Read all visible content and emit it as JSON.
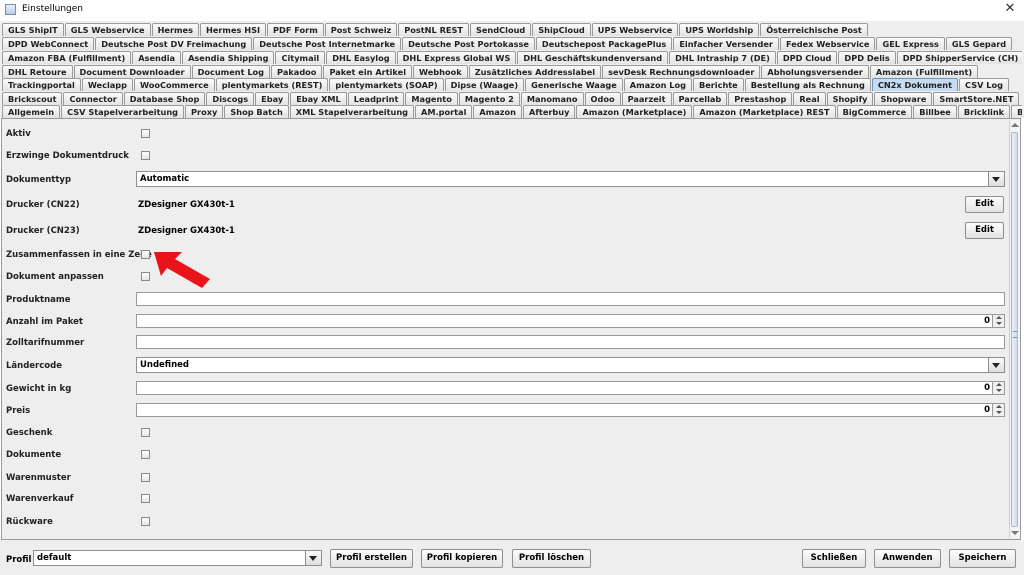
{
  "window": {
    "title": "Einstellungen"
  },
  "tabs": {
    "row1": [
      "GLS ShipIT",
      "GLS Webservice",
      "Hermes",
      "Hermes HSI",
      "PDF Form",
      "Post Schweiz",
      "PostNL REST",
      "SendCloud",
      "ShipCloud",
      "UPS Webservice",
      "UPS Worldship",
      "Österreichische Post"
    ],
    "row2": [
      "DPD WebConnect",
      "Deutsche Post DV Freimachung",
      "Deutsche Post Internetmarke",
      "Deutsche Post Portokasse",
      "Deutschepost PackagePlus",
      "Einfacher Versender",
      "Fedex Webservice",
      "GEL Express",
      "GLS Gepard"
    ],
    "row3": [
      "Amazon FBA (Fulfillment)",
      "Asendia",
      "Asendia Shipping",
      "Citymail",
      "DHL Easylog",
      "DHL Express Global WS",
      "DHL Geschäftskundenversand",
      "DHL Intraship 7 (DE)",
      "DPD Cloud",
      "DPD Delis",
      "DPD ShipperService (CH)"
    ],
    "row4": [
      "DHL Retoure",
      "Document Downloader",
      "Document Log",
      "Pakadoo",
      "Paket ein Artikel",
      "Webhook",
      "Zusätzliches Addresslabel",
      "sevDesk Rechnungsdownloader",
      "Abholungsversender",
      "Amazon (Fulfillment)"
    ],
    "row5": [
      "Trackingportal",
      "Weclapp",
      "WooCommerce",
      "plentymarkets (REST)",
      "plentymarkets (SOAP)",
      "Dipse (Waage)",
      "Generische Waage",
      "Amazon Log",
      "Berichte",
      "Bestellung als Rechnung",
      "CN2x Dokument",
      "CSV Log"
    ],
    "row6": [
      "Brickscout",
      "Connector",
      "Database Shop",
      "Discogs",
      "Ebay",
      "Ebay XML",
      "Leadprint",
      "Magento",
      "Magento 2",
      "Manomano",
      "Odoo",
      "Paarzeit",
      "Parcellab",
      "Prestashop",
      "Real",
      "Shopify",
      "Shopware",
      "SmartStore.NET"
    ],
    "row7": [
      "Allgemein",
      "CSV Stapelverarbeitung",
      "Proxy",
      "Shop Batch",
      "XML Stapelverarbeitung",
      "AM.portal",
      "Amazon",
      "Afterbuy",
      "Amazon (Marketplace)",
      "Amazon (Marketplace) REST",
      "BigCommerce",
      "Billbee",
      "Bricklink",
      "Brickowl"
    ],
    "active": "CN2x Dokument"
  },
  "form": {
    "aktiv": "Aktiv",
    "erzwinge": "Erzwinge Dokumentdruck",
    "dokumenttyp": {
      "label": "Dokumenttyp",
      "value": "Automatic"
    },
    "drucker_cn22": {
      "label": "Drucker (CN22)",
      "value": "ZDesigner GX430t-1",
      "button": "Edit"
    },
    "drucker_cn23": {
      "label": "Drucker (CN23)",
      "value": "ZDesigner GX430t-1",
      "button": "Edit"
    },
    "zusammenfassen": "Zusammenfassen in eine Zeile",
    "anpassen": "Dokument anpassen",
    "produktname": "Produktname",
    "anzahl": {
      "label": "Anzahl im Paket",
      "value": "0"
    },
    "zolltarif": "Zolltarifnummer",
    "laendercode": {
      "label": "Ländercode",
      "value": "Undefined"
    },
    "gewicht": {
      "label": "Gewicht in kg",
      "value": "0"
    },
    "preis": {
      "label": "Preis",
      "value": "0"
    },
    "geschenk": "Geschenk",
    "dokumente": "Dokumente",
    "warenmuster": "Warenmuster",
    "warenverkauf": "Warenverkauf",
    "rueckware": "Rückware"
  },
  "bottom": {
    "profil_label": "Profil",
    "profil_value": "default",
    "erstellen": "Profil erstellen",
    "kopieren": "Profil kopieren",
    "loeschen": "Profil löschen",
    "schliessen": "Schließen",
    "anwenden": "Anwenden",
    "speichern": "Speichern"
  },
  "colors": {
    "active_tab": "#c6dcf2",
    "annotation_arrow": "#e8141a",
    "background": "#eeeeee"
  }
}
